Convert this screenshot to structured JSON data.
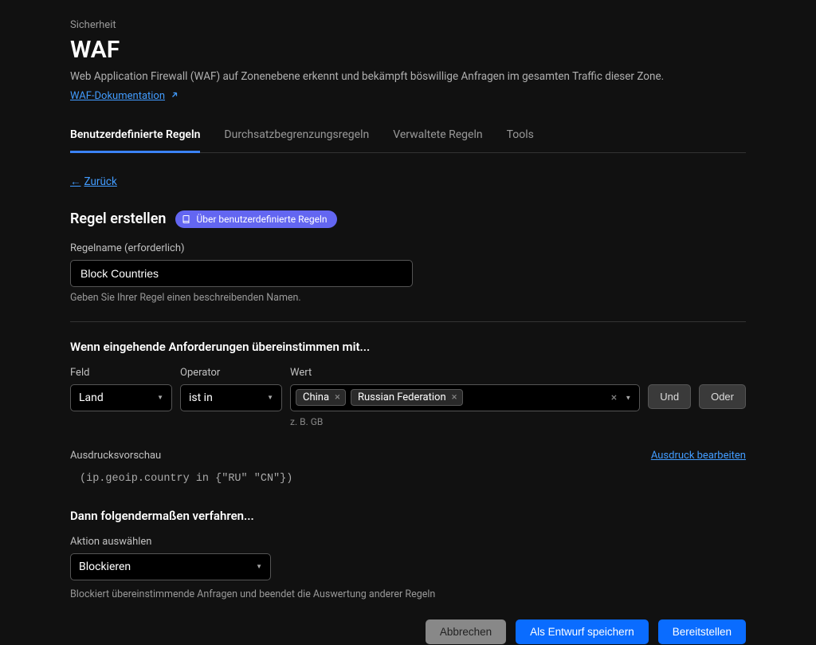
{
  "breadcrumb": "Sicherheit",
  "page_title": "WAF",
  "page_description": "Web Application Firewall (WAF) auf Zonenebene erkennt und bekämpft böswillige Anfragen im gesamten Traffic dieser Zone.",
  "doc_link_label": "WAF-Dokumentation",
  "tabs": [
    "Benutzerdefinierte Regeln",
    "Durchsatzbegrenzungsregeln",
    "Verwaltete Regeln",
    "Tools"
  ],
  "back_label": "Zurück",
  "create_rule_title": "Regel erstellen",
  "info_badge_label": "Über benutzerdefinierte Regeln",
  "rule_name_label": "Regelname (erforderlich)",
  "rule_name_value": "Block Countries",
  "rule_name_helper": "Geben Sie Ihrer Regel einen beschreibenden Namen.",
  "when_title": "Wenn eingehende Anforderungen übereinstimmen mit...",
  "field_label": "Feld",
  "field_value": "Land",
  "operator_label": "Operator",
  "operator_value": "ist in",
  "value_label": "Wert",
  "value_chips": [
    "China",
    "Russian Federation"
  ],
  "value_hint": "z. B. GB",
  "and_label": "Und",
  "or_label": "Oder",
  "preview_label": "Ausdrucksvorschau",
  "edit_expression_label": "Ausdruck bearbeiten",
  "expression_code": "(ip.geoip.country in {\"RU\" \"CN\"})",
  "then_title": "Dann folgendermaßen verfahren...",
  "action_label": "Aktion auswählen",
  "action_value": "Blockieren",
  "action_desc": "Blockiert übereinstimmende Anfragen und beendet die Auswertung anderer Regeln",
  "btn_cancel": "Abbrechen",
  "btn_draft": "Als Entwurf speichern",
  "btn_deploy": "Bereitstellen"
}
